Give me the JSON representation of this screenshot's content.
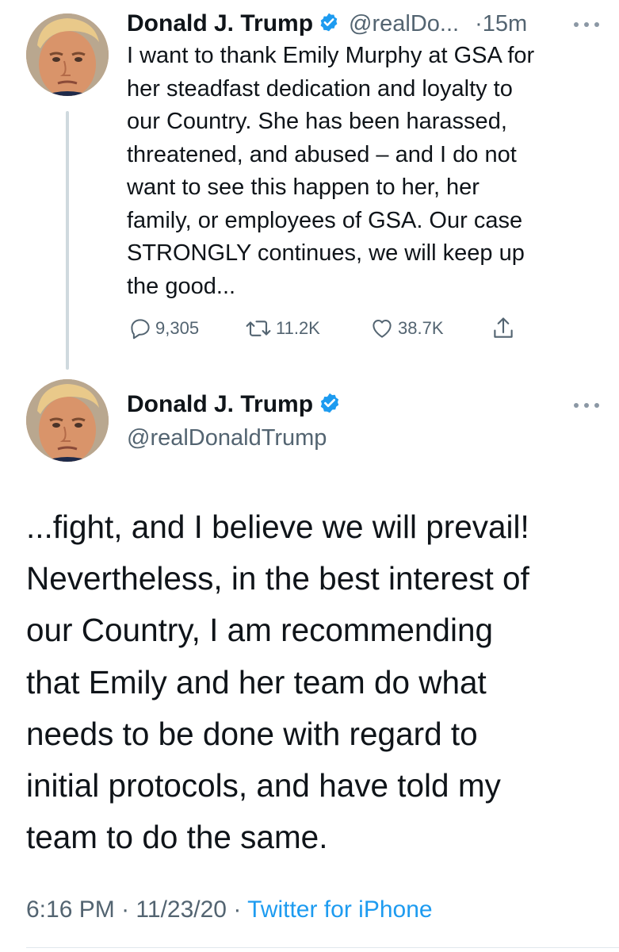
{
  "tweet1": {
    "name": "Donald J. Trump",
    "handle": "@realDo...",
    "time": "·15m",
    "text": "I want to thank Emily Murphy at GSA for\nher steadfast dedication and loyalty to\nour Country. She has been harassed,\nthreatened, and abused – and I do not\nwant to see this happen to her, her\nfamily, or employees of GSA. Our case\nSTRONGLY continues, we will keep up\nthe good...",
    "replies": "9,305",
    "retweets": "11.2K",
    "likes": "38.7K"
  },
  "tweet2": {
    "name": "Donald J. Trump",
    "handle": "@realDonaldTrump",
    "text": "...fight, and I believe we will prevail!\nNevertheless, in the best interest of\nour Country, I am recommending\nthat Emily and her team do what\nneeds to be done with regard to\ninitial protocols, and have told my\nteam to do the same.",
    "time": "6:16 PM",
    "date": "11/23/20",
    "separator": "·",
    "source": "Twitter for iPhone"
  },
  "colors": {
    "text": "#0f1419",
    "secondary": "#536471",
    "link": "#1d9bf0",
    "verified": "#1d9bf0",
    "thread_line": "#cfd9de"
  },
  "icons": [
    "verified-badge-icon",
    "more-icon",
    "reply-icon",
    "retweet-icon",
    "like-icon",
    "share-icon"
  ]
}
